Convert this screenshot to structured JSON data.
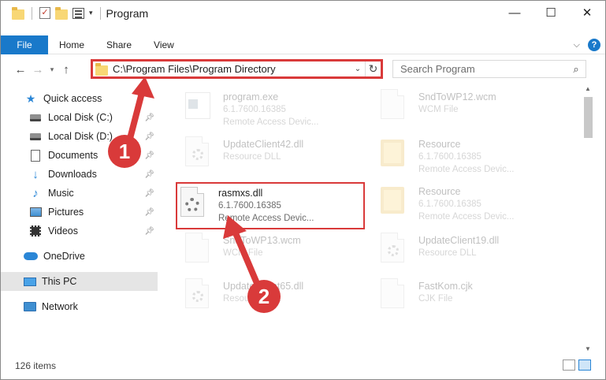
{
  "window": {
    "title": "Program",
    "minimize_icon": "minimize-icon",
    "maximize_icon": "maximize-icon",
    "close_icon": "close-icon"
  },
  "ribbon": {
    "tabs": [
      "File",
      "Home",
      "Share",
      "View"
    ]
  },
  "nav": {
    "address": "C:\\Program Files\\Program Directory",
    "search_placeholder": "Search Program"
  },
  "sidebar": {
    "items": [
      {
        "label": "Quick access",
        "icon": "star-icon"
      },
      {
        "label": "Local Disk (C:)",
        "icon": "disk-icon",
        "pinned": true
      },
      {
        "label": "Local Disk (D:)",
        "icon": "disk-icon",
        "pinned": true
      },
      {
        "label": "Documents",
        "icon": "documents-icon",
        "pinned": true
      },
      {
        "label": "Downloads",
        "icon": "download-icon",
        "pinned": true
      },
      {
        "label": "Music",
        "icon": "music-icon",
        "pinned": true
      },
      {
        "label": "Pictures",
        "icon": "pictures-icon",
        "pinned": true
      },
      {
        "label": "Videos",
        "icon": "videos-icon",
        "pinned": true
      },
      {
        "label": "OneDrive",
        "icon": "cloud-icon"
      },
      {
        "label": "This PC",
        "icon": "computer-icon",
        "selected": true
      },
      {
        "label": "Network",
        "icon": "network-icon"
      }
    ]
  },
  "files": {
    "left": [
      {
        "name": "program.exe",
        "version": "6.1.7600.16385",
        "desc": "Remote Access Devic...",
        "icon": "exe-icon"
      },
      {
        "name": "UpdateClient42.dll",
        "version": "",
        "desc": "Resource DLL",
        "icon": "dll-icon"
      },
      {
        "name": "rasmxs.dll",
        "version": "6.1.7600.16385",
        "desc": "Remote Access Devic...",
        "icon": "dll-icon",
        "highlighted": true
      },
      {
        "name": "SndToWP13.wcm",
        "version": "",
        "desc": "WCM File",
        "icon": "file-icon"
      },
      {
        "name": "UpdateClient65.dll",
        "version": "",
        "desc": "Resource DLL",
        "icon": "dll-icon"
      }
    ],
    "right": [
      {
        "name": "SndToWP12.wcm",
        "version": "",
        "desc": "WCM File",
        "icon": "file-icon"
      },
      {
        "name": "Resource",
        "version": "6.1.7600.16385",
        "desc": "Remote Access Devic...",
        "icon": "folder-icon"
      },
      {
        "name": "Resource",
        "version": "6.1.7600.16385",
        "desc": "Remote Access Devic...",
        "icon": "folder-icon"
      },
      {
        "name": "UpdateClient19.dll",
        "version": "",
        "desc": "Resource DLL",
        "icon": "dll-icon"
      },
      {
        "name": "FastKom.cjk",
        "version": "",
        "desc": "CJK File",
        "icon": "file-icon"
      }
    ]
  },
  "status": {
    "item_count": "126 items"
  },
  "annotations": {
    "step1": "1",
    "step2": "2",
    "color": "#d93a3a"
  }
}
